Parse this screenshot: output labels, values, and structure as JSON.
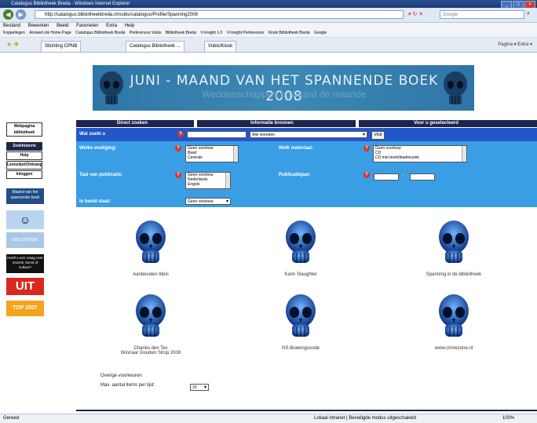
{
  "browser": {
    "title": "Catalogus Bibliotheek Breda - Windows Internet Explorer",
    "url": "http://catalogus.bibliotheekbreda.nl/vubis/catalogus/Profile/Spanning2008",
    "search_placeholder": "Google",
    "menu": [
      "Bestand",
      "Bewerken",
      "Beeld",
      "Favorieten",
      "Extra",
      "Help"
    ],
    "favorites_label": "Koppelingen",
    "favorites": [
      "AnswerLink Home Page",
      "Catalogus Bibliotheek Breda",
      "Preferences Vubis",
      "Bibliotheek Breda",
      "V-Insight 1.0",
      "V-Insight Preferences",
      "Kiosk Bibliotheek Breda",
      "Google"
    ],
    "tabs": [
      "Stichting CPNB",
      "Catalogus Bibliotheek ...",
      "Vubis/Kiosk"
    ],
    "toolbar_right": "Pagina  ▾  Extra ▾",
    "status_left": "Gereed",
    "status_mid": "Lokaal intranet | Beveiligde modus uitgeschakeld",
    "zoom": "100%"
  },
  "banner": {
    "title": "JUNI - MAAND VAN HET SPANNENDE BOEK 2008",
    "subtitle": "Weddenschappen bewaard de maande"
  },
  "sidebar": {
    "links": [
      "Webpagina bibliotheek",
      "Zoekhistorie",
      "Help",
      "Leenslijst/Ontvangen",
      "Inloggen"
    ],
    "promos": [
      "Maand van het spannende boek",
      "",
      "BIBLIOTHEEK BREDA",
      "Heeft u een vraag over muziek, kunst of cultuur?",
      "UIT",
      "TOP 2007"
    ]
  },
  "search": {
    "tabs": [
      "Direct zoeken",
      "Informatie bronnen",
      "Voor u geselecteerd"
    ],
    "query_label": "Wat zoekt u",
    "query_value": "",
    "scope_value": "Alle woorden",
    "go_label": "Vind",
    "labels": {
      "vestiging": "Welke vestiging:",
      "materiaal": "Welk materiaal:",
      "taal": "Taal van publicatie:",
      "jaar": "Publicatiejaar:",
      "staat": "In beeld staat:"
    },
    "vestiging_options": [
      "Geen voorkeur",
      "Baarl",
      "Centrale"
    ],
    "materiaal_options": [
      "Geen voorkeur",
      "CD",
      "CD met boek/bladmuziek"
    ],
    "taal_options": [
      "Geen voorkeur",
      "Nederlands",
      "Engels"
    ],
    "staat_value": "Geen voorkeur",
    "year_from": "",
    "year_to": ""
  },
  "items": [
    {
      "caption": "Aanbevolen titels"
    },
    {
      "caption": "Karin Slaughter"
    },
    {
      "caption": "Spanning in de bibliotheek"
    },
    {
      "caption": "Charles den Tex\nWinnaar Gouden Strop 2008"
    },
    {
      "caption": "NS-Boekingscode"
    },
    {
      "caption": "www.crimezone.nl"
    }
  ],
  "bottom": {
    "overige": "Overige voorkeuren",
    "max_label": "Max. aantal items per lijst:",
    "max_value": "10"
  },
  "colors": {
    "navy": "#1c2450",
    "blue": "#2257c9",
    "panel": "#3a9ee4",
    "banner": "#3d88b5"
  }
}
